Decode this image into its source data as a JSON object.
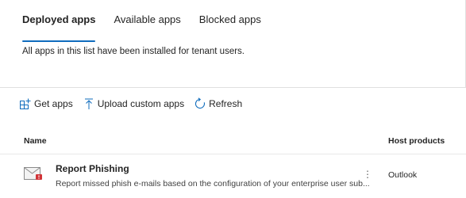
{
  "tabs": [
    {
      "label": "Deployed apps",
      "active": true
    },
    {
      "label": "Available apps",
      "active": false
    },
    {
      "label": "Blocked apps",
      "active": false
    }
  ],
  "description": "All apps in this list have been installed for tenant users.",
  "toolbar": {
    "get_apps": "Get apps",
    "upload": "Upload custom apps",
    "refresh": "Refresh"
  },
  "table": {
    "columns": {
      "name": "Name",
      "host": "Host products"
    },
    "rows": [
      {
        "name": "Report Phishing",
        "description": "Report missed phish e-mails based on the configuration of your enterprise user sub...",
        "host": "Outlook",
        "icon": "report-phishing-icon"
      }
    ]
  },
  "colors": {
    "accent": "#0f6cbd",
    "icon_red": "#d13438"
  }
}
